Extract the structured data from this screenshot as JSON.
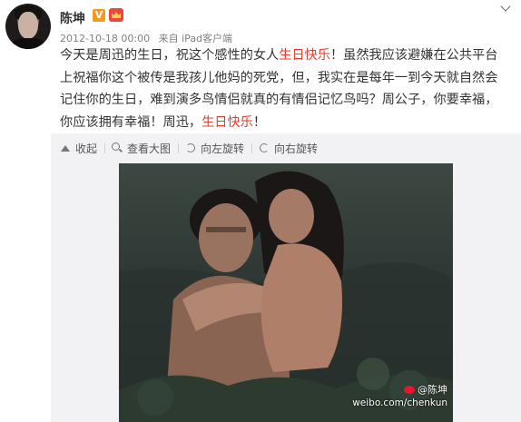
{
  "post": {
    "author": "陈坤",
    "verified_badge": "V",
    "timestamp": "2012-10-18 00:00",
    "source": "来自 iPad客户端",
    "text_parts": [
      "今天是周迅的生日，祝这个感性的女人",
      "生日快乐",
      "！虽然我应该避嫌在公共平台上祝福你这个被传是我孩儿他妈的死党，但，我实在是每年一到今天就自然会记住你的生日，难到演多鸟情侣就真的有情侣记忆鸟吗？周公子，你要幸福，你应该拥有幸福！周迅，",
      "生日快乐",
      "！"
    ],
    "highlight_color": "#eb3a2c"
  },
  "toolbar": {
    "collapse_label": "收起",
    "view_large_label": "查看大图",
    "rotate_left_label": "向左旋转",
    "rotate_right_label": "向右旋转"
  },
  "photo": {
    "watermark_handle": "@陈坤",
    "watermark_url": "weibo.com/chenkun"
  },
  "icons": {
    "menu": "chevron-down-icon",
    "verified": "verified-icon",
    "vip": "vip-icon"
  }
}
